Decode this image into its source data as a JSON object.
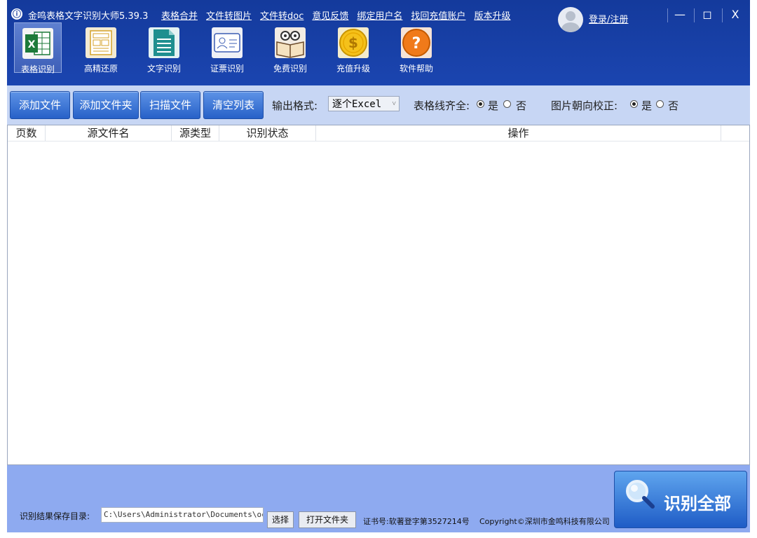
{
  "window": {
    "title": "金鸣表格文字识别大师5.39.3",
    "menu": [
      "表格合并",
      "文件转图片",
      "文件转doc",
      "意见反馈",
      "绑定用户名",
      "找回充值账户",
      "版本升级"
    ],
    "login": "登录/注册",
    "controls": {
      "minimize": "—",
      "maximize": "◻",
      "close": "X"
    }
  },
  "tools": [
    {
      "label": "表格识别",
      "icon": "excel-icon"
    },
    {
      "label": "高精还原",
      "icon": "layout-icon"
    },
    {
      "label": "文字识别",
      "icon": "document-icon"
    },
    {
      "label": "证票识别",
      "icon": "id-card-icon"
    },
    {
      "label": "免费识别",
      "icon": "book-icon"
    },
    {
      "label": "充值升级",
      "icon": "coin-icon"
    },
    {
      "label": "软件帮助",
      "icon": "help-icon"
    }
  ],
  "toolbar": {
    "add_file": "添加文件",
    "add_folder": "添加文件夹",
    "scan_file": "扫描文件",
    "clear_list": "清空列表",
    "output_format_label": "输出格式:",
    "output_format_value": "逐个Excel",
    "table_line_label": "表格线齐全:",
    "orientation_label": "图片朝向校正:",
    "yes": "是",
    "no": "否"
  },
  "table": {
    "columns": [
      "页数",
      "源文件名",
      "源类型",
      "识别状态",
      "操作"
    ],
    "rows": []
  },
  "bottom": {
    "save_dir_label": "识别结果保存目录:",
    "save_dir_value": "C:\\Users\\Administrator\\Documents\\oc",
    "choose": "选择",
    "open_folder": "打开文件夹",
    "cert": "证书号:软著登字第3527214号",
    "copyright": "Copyright©深圳市金鸣科技有限公司",
    "recognize_all": "识别全部"
  },
  "colors": {
    "title_bar": "#1a3e9e",
    "toolbar_bg": "#c7d6f4",
    "bottom_bg": "#8eaaf0",
    "button": "#2761c8"
  }
}
